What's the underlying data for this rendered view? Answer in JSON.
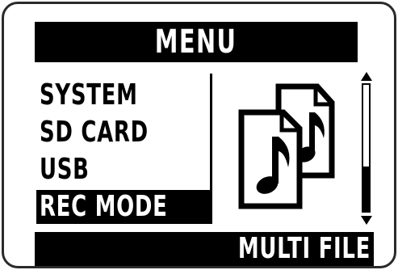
{
  "header": {
    "title": "MENU"
  },
  "menu": {
    "items": [
      {
        "label": "SYSTEM"
      },
      {
        "label": "SD CARD"
      },
      {
        "label": "USB"
      },
      {
        "label": "REC MODE"
      }
    ],
    "selected_index": 3
  },
  "preview": {
    "icon": "multi-file-icon"
  },
  "scrollbar": {
    "position": 1.0,
    "thumb_fraction": 0.35
  },
  "footer": {
    "value": "MULTI FILE"
  },
  "colors": {
    "foreground": "#000000",
    "background": "#ffffff"
  }
}
